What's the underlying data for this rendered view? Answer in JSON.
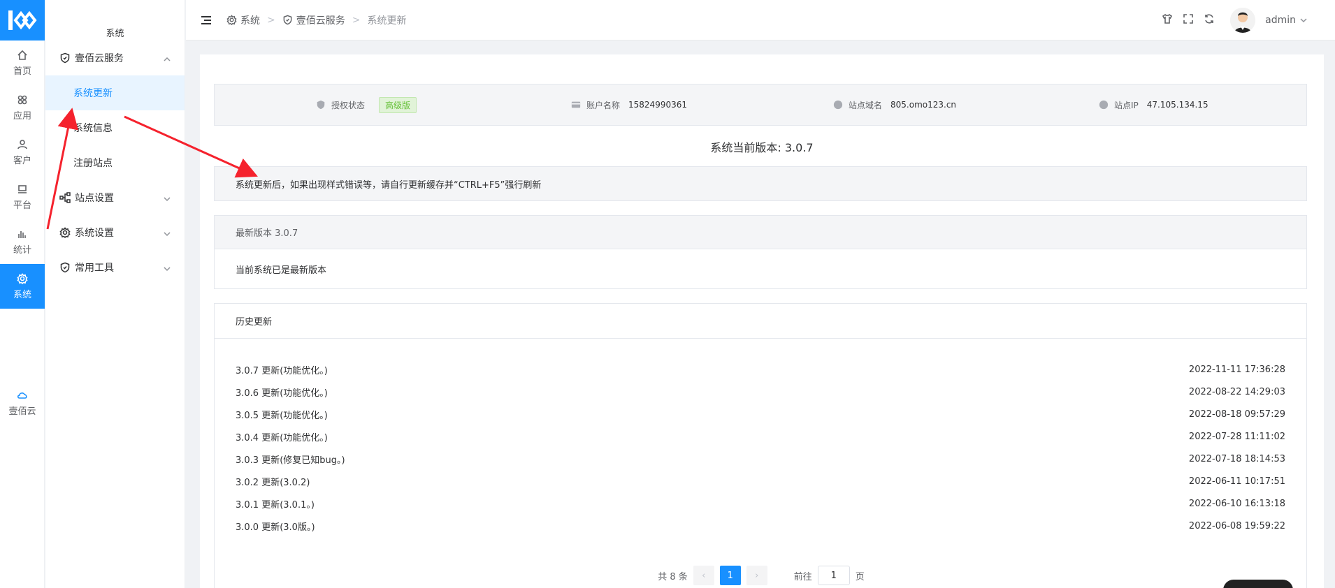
{
  "rail": {
    "items": [
      {
        "label": "首页",
        "icon": "home-icon"
      },
      {
        "label": "应用",
        "icon": "apps-icon"
      },
      {
        "label": "客户",
        "icon": "user-icon"
      },
      {
        "label": "平台",
        "icon": "monitor-icon"
      },
      {
        "label": "统计",
        "icon": "bar-chart-icon"
      },
      {
        "label": "系统",
        "icon": "gear-icon"
      }
    ],
    "cloud_label": "壹佰云"
  },
  "sidebar": {
    "title": "系统",
    "group_main": "壹佰云服务",
    "items": [
      "系统更新",
      "系统信息",
      "注册站点"
    ],
    "groups": [
      "站点设置",
      "系统设置",
      "常用工具"
    ]
  },
  "header": {
    "breadcrumb": [
      "系统",
      "壹佰云服务",
      "系统更新"
    ],
    "username": "admin"
  },
  "info": {
    "auth_label": "授权状态",
    "auth_badge": "高级版",
    "account_label": "账户名称",
    "account_value": "15824990361",
    "domain_label": "站点域名",
    "domain_value": "805.omo123.cn",
    "ip_label": "站点IP",
    "ip_value": "47.105.134.15"
  },
  "current_version": "系统当前版本: 3.0.7",
  "notice": "系统更新后，如果出现样式错误等，请自行更新缓存并“CTRL+F5”强行刷新",
  "latest": {
    "title": "最新版本 3.0.7",
    "message": "当前系统已是最新版本"
  },
  "history": {
    "title": "历史更新",
    "rows": [
      {
        "text": "3.0.7 更新(功能优化。)",
        "date": "2022-11-11 17:36:28"
      },
      {
        "text": "3.0.6 更新(功能优化。)",
        "date": "2022-08-22 14:29:03"
      },
      {
        "text": "3.0.5 更新(功能优化。)",
        "date": "2022-08-18 09:57:29"
      },
      {
        "text": "3.0.4 更新(功能优化。)",
        "date": "2022-07-28 11:11:02"
      },
      {
        "text": "3.0.3 更新(修复已知bug。)",
        "date": "2022-07-18 18:14:53"
      },
      {
        "text": "3.0.2 更新(3.0.2)",
        "date": "2022-06-11 10:17:51"
      },
      {
        "text": "3.0.1 更新(3.0.1。)",
        "date": "2022-06-10 16:13:18"
      },
      {
        "text": "3.0.0 更新(3.0版。)",
        "date": "2022-06-08 19:59:22"
      }
    ]
  },
  "pagination": {
    "total": "共 8 条",
    "current": "1",
    "goto_label": "前往",
    "goto_value": "1",
    "page_suffix": "页"
  },
  "colors": {
    "accent": "#1890ff",
    "badge_green": "#67c23a",
    "arrow_red": "#f5222d"
  }
}
